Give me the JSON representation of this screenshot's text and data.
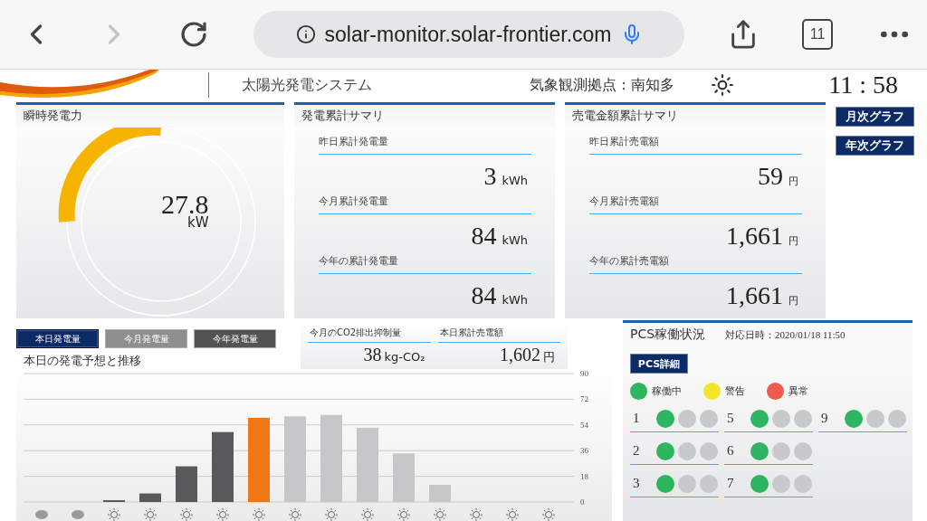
{
  "browser": {
    "url": "solar-monitor.solar-frontier.com",
    "tab_count": "11",
    "forward_disabled": true
  },
  "header": {
    "system_title": "太陽光発電システム",
    "station": "気象観測拠点：南知多",
    "time": "11 : 58"
  },
  "instant_power": {
    "title": "瞬時発電力",
    "value": "27.8",
    "unit": "kW",
    "level": 0.25
  },
  "generation_summary": {
    "title": "発電累計サマリ",
    "items": [
      {
        "label": "昨日累計発電量",
        "value": "3",
        "unit": "kWh"
      },
      {
        "label": "今月累計発電量",
        "value": "84",
        "unit": "kWh"
      },
      {
        "label": "今年の累計発電量",
        "value": "84",
        "unit": "kWh"
      }
    ]
  },
  "sales_summary": {
    "title": "売電金額累計サマリ",
    "items": [
      {
        "label": "昨日累計売電額",
        "value": "59",
        "unit": "円"
      },
      {
        "label": "今月累計売電額",
        "value": "1,661",
        "unit": "円"
      },
      {
        "label": "今年の累計売電額",
        "value": "1,661",
        "unit": "円"
      }
    ]
  },
  "graph_buttons": [
    "月次グラフ",
    "年次グラフ"
  ],
  "period_tabs": [
    {
      "label": "本日発電量",
      "selected": true,
      "color": "#0c2a66"
    },
    {
      "label": "今月発電量",
      "selected": false,
      "color": "#8a8a8a"
    },
    {
      "label": "今年発電量",
      "selected": false,
      "color": "#4a4a4a"
    }
  ],
  "monthly_stats": [
    {
      "label": "今月のCO2排出抑制量",
      "value": "38",
      "unit": "kg-CO₂"
    },
    {
      "label": "本日累計売電額",
      "value": "1,602",
      "unit": "円"
    }
  ],
  "forecast": {
    "title": "本日の発電予想と推移",
    "chart_data": {
      "type": "bar",
      "values": [
        0,
        0,
        1,
        6,
        25,
        49,
        59,
        60,
        61,
        52,
        34,
        12,
        0,
        0,
        0
      ],
      "ylim": [
        0,
        90
      ],
      "yticks": [
        0,
        18,
        36,
        54,
        72,
        90
      ],
      "grid": true
    },
    "bars": [
      {
        "kind": "cloud"
      },
      {
        "kind": "cloud"
      },
      {
        "color": "#58595b",
        "kind": "sun"
      },
      {
        "color": "#58595b",
        "kind": "sun"
      },
      {
        "color": "#58595b",
        "kind": "sun"
      },
      {
        "color": "#58595b",
        "kind": "sun"
      },
      {
        "color": "#f07814",
        "kind": "sun"
      },
      {
        "color": "#c5c7c9",
        "kind": "sun"
      },
      {
        "color": "#c5c7c9",
        "kind": "sun"
      },
      {
        "color": "#c5c7c9",
        "kind": "sun"
      },
      {
        "color": "#c5c7c9",
        "kind": "sun"
      },
      {
        "color": "#c5c7c9",
        "kind": "sun"
      },
      {
        "kind": "sun"
      },
      {
        "kind": "sun"
      },
      {
        "kind": "sun"
      }
    ]
  },
  "pcs": {
    "title": "PCS稼働状況",
    "timestamp": "対応日時：2020/01/18 11:50",
    "detail_button": "PCS詳細",
    "legend": [
      {
        "label": "稼働中",
        "color": "#2fb55f"
      },
      {
        "label": "警告",
        "color": "#f5e52a"
      },
      {
        "label": "異常",
        "color": "#ee5a4e"
      }
    ],
    "columns": [
      [
        {
          "label": "1",
          "kind": "running"
        },
        {
          "label": "2",
          "kind": "running"
        },
        {
          "label": "3",
          "kind": "running"
        }
      ],
      [
        {
          "label": "5",
          "kind": "running"
        },
        {
          "label": "6",
          "kind": "running"
        },
        {
          "label": "7",
          "kind": "running"
        }
      ],
      [
        {
          "label": "9",
          "kind": "running"
        }
      ]
    ]
  }
}
